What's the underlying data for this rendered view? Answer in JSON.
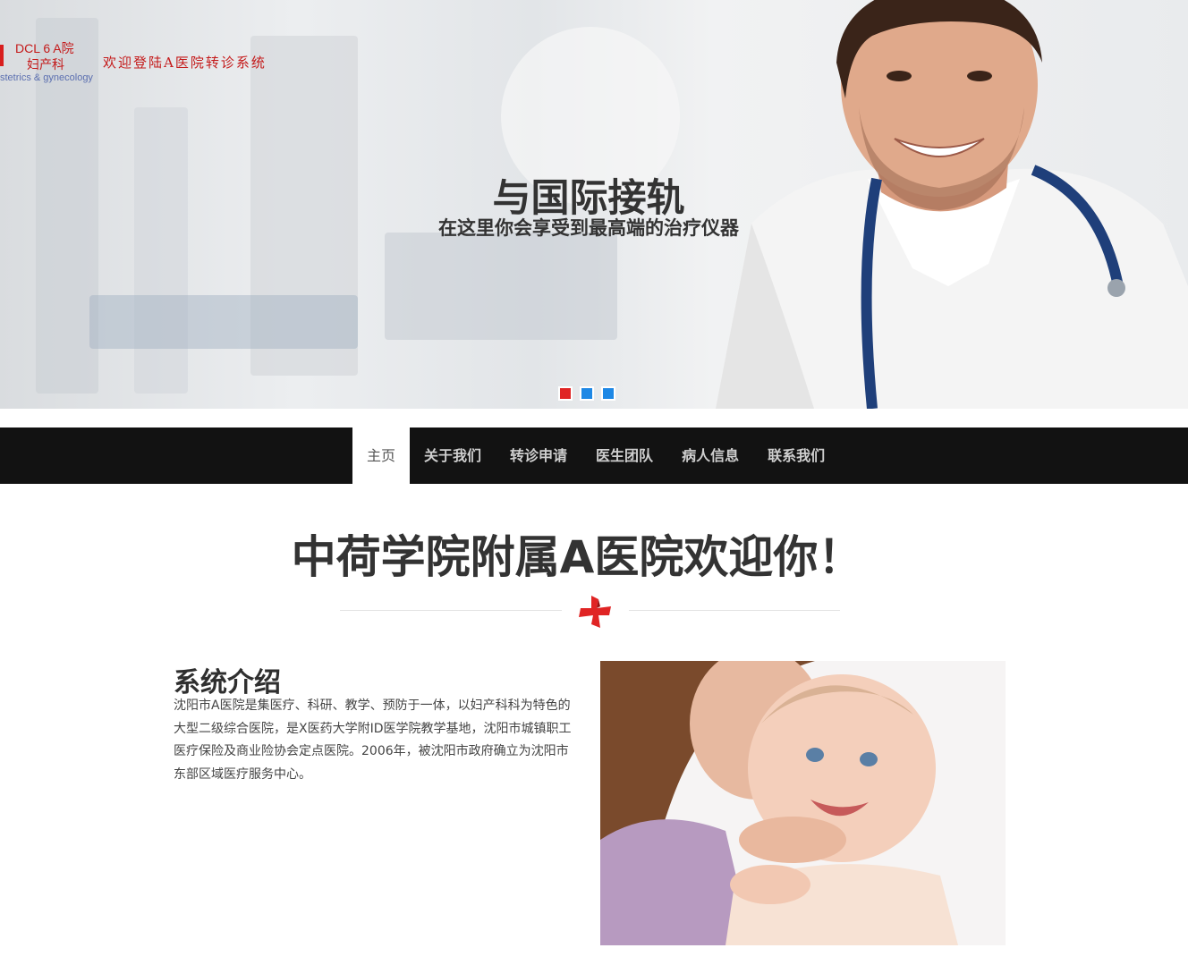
{
  "brand": {
    "line1": "DCL 6 A院",
    "line2": "妇产科",
    "line3": "stetrics & gynecology",
    "welcome": "欢迎登陆A医院转诊系统"
  },
  "hero": {
    "title": "与国际接轨",
    "subtitle": "在这里你会享受到最高端的治疗仪器",
    "slider": {
      "slides": 3,
      "active_index": 0,
      "dot_colors": [
        "#e02424",
        "#1e88e5",
        "#1e88e5"
      ]
    }
  },
  "nav": {
    "items": [
      {
        "label": "主页",
        "active": true
      },
      {
        "label": "关于我们",
        "active": false
      },
      {
        "label": "转诊申请",
        "active": false
      },
      {
        "label": "医生团队",
        "active": false
      },
      {
        "label": "病人信息",
        "active": false
      },
      {
        "label": "联系我们",
        "active": false
      }
    ]
  },
  "main": {
    "title": "中荷学院附属A医院欢迎你！",
    "divider_icon": "red-cross-icon",
    "intro": {
      "title": "系统介绍",
      "text": "沈阳市A医院是集医疗、科研、教学、预防于一体，以妇产科科为特色的大型二级综合医院，是X医药大学附ID医学院教学基地，沈阳市城镇职工医疗保险及商业险协会定点医院。2006年，被沈阳市政府确立为沈阳市东部区域医疗服务中心。"
    }
  },
  "colors": {
    "accent_red": "#d81e1e",
    "nav_bg": "#121212",
    "text_dark": "#333333"
  }
}
